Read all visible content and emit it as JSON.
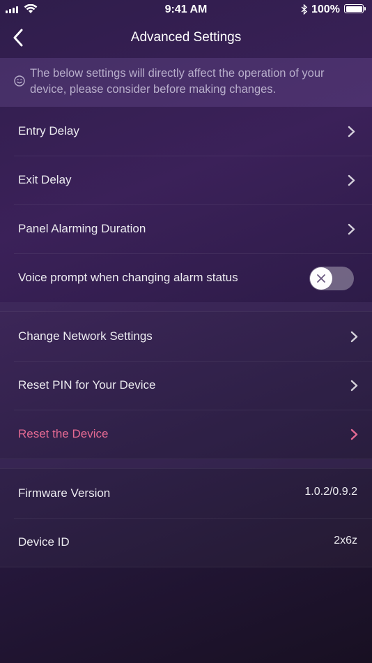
{
  "status_bar": {
    "time": "9:41 AM",
    "battery": "100%",
    "icons": [
      "signal-icon",
      "wifi-icon",
      "bluetooth-icon",
      "battery-icon"
    ]
  },
  "nav": {
    "title": "Advanced Settings",
    "back_icon": "chevron-left-icon"
  },
  "notice": {
    "icon": "smiley-icon",
    "text": "The below settings will directly affect the operation of your device, please consider before making changes."
  },
  "alarm_settings": {
    "entry_delay": "Entry Delay",
    "exit_delay": "Exit Delay",
    "panel_alarming_duration": "Panel Alarming Duration",
    "voice_prompt": "Voice prompt when changing alarm status",
    "voice_prompt_enabled": false
  },
  "device_actions": {
    "change_network": "Change Network Settings",
    "reset_pin": "Reset PIN for Your Device",
    "reset_device": "Reset the Device"
  },
  "device_info": {
    "firmware_label": "Firmware Version",
    "firmware_value": "1.0.2/0.9.2",
    "device_id_label": "Device ID",
    "device_id_value": "2x6z"
  },
  "colors": {
    "danger": "#e56a93",
    "notice_text": "#b8aecb"
  }
}
